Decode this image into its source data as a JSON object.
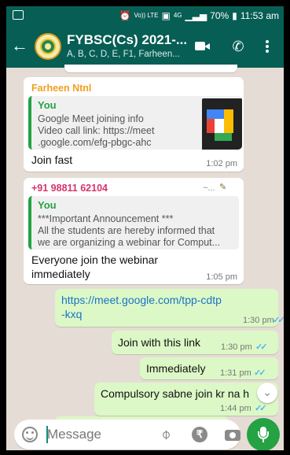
{
  "status_bar": {
    "network_labels": "Vo)) LTE",
    "signal": "4G",
    "battery": "70%",
    "time": "11:53 am"
  },
  "header": {
    "back_icon": "arrow-left-icon",
    "title": "FYBSC(Cs) 2021-...",
    "members": "A, B, C, D, E, F1, Farheen...",
    "video_icon": "video-call-icon",
    "call_icon": "phone-icon",
    "menu_icon": "more-vert-icon"
  },
  "colors": {
    "header": "#075e54",
    "background": "#e5ddd5",
    "outgoing": "#dcf8c6",
    "accent_green": "#25a244",
    "tick_blue": "#4fb6ec"
  },
  "messages": [
    {
      "sender": "Farheen Ntnl",
      "sender_color": "#f0a020",
      "quote_author": "You",
      "quote_lines": [
        "Google Meet joining info",
        "Video call link: https://meet",
        ".google.com/efg-pbgc-ahc"
      ],
      "text": "Join fast",
      "time": "1:02 pm"
    },
    {
      "sender": "+91 98811 62104",
      "sender_color": "#d6336c",
      "sender_alias": "~...",
      "quote_author": "You",
      "quote_lines": [
        "***Important Announcement ***",
        "All the students are hereby informed that",
        "we are organizing a webinar for Comput..."
      ],
      "text_lines": [
        "Everyone join the webinar",
        "immediately"
      ],
      "time": "1:05 pm"
    },
    {
      "text_lines": [
        "https://meet.google.com/tpp-cdtp",
        "-kxq"
      ],
      "time": "1:30 pm",
      "ticks": "✓✓"
    },
    {
      "text": "Join with this link",
      "time": "1:30 pm",
      "ticks": "✓✓"
    },
    {
      "text": "Immediately",
      "time": "1:31 pm",
      "ticks": "✓✓"
    },
    {
      "text": "Compulsory sabne join kr na h",
      "time": "1:44 pm",
      "ticks": "✓✓"
    }
  ],
  "input": {
    "placeholder": "Message",
    "emoji_icon": "emoji-icon",
    "attach_icon": "paperclip-icon",
    "payment_icon": "rupee-icon",
    "camera_icon": "camera-icon",
    "mic_icon": "mic-icon",
    "scroll_icon": "double-chevron-down-icon"
  }
}
